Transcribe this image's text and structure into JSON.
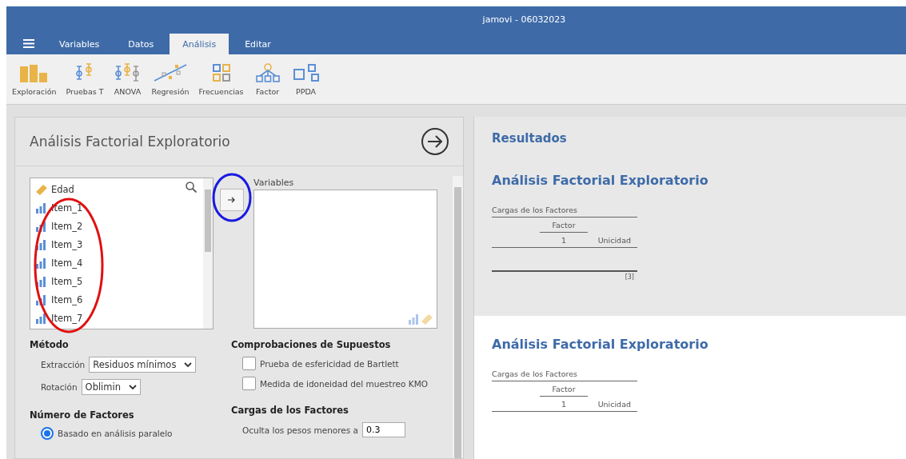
{
  "window": {
    "title": "jamovi - 06032023"
  },
  "tabs": [
    {
      "label": "Variables",
      "selected": false
    },
    {
      "label": "Datos",
      "selected": false
    },
    {
      "label": "Análisis",
      "selected": true
    },
    {
      "label": "Editar",
      "selected": false
    }
  ],
  "ribbon": [
    {
      "label": "Exploración",
      "kind": "exploration"
    },
    {
      "label": "Pruebas T",
      "kind": "ttest"
    },
    {
      "label": "ANOVA",
      "kind": "anova"
    },
    {
      "label": "Regresión",
      "kind": "regression"
    },
    {
      "label": "Frecuencias",
      "kind": "frequencies"
    },
    {
      "label": "Factor",
      "kind": "factor"
    },
    {
      "label": "PPDA",
      "kind": "ppda"
    }
  ],
  "analysis_panel": {
    "title": "Análisis Factorial Exploratorio",
    "source_list": [
      {
        "name": "Edad",
        "kind": "continuous"
      },
      {
        "name": "Item_1",
        "kind": "ordinal"
      },
      {
        "name": "Item_2",
        "kind": "ordinal"
      },
      {
        "name": "Item_3",
        "kind": "ordinal"
      },
      {
        "name": "Item_4",
        "kind": "ordinal"
      },
      {
        "name": "Item_5",
        "kind": "ordinal"
      },
      {
        "name": "Item_6",
        "kind": "ordinal"
      },
      {
        "name": "Item_7",
        "kind": "ordinal"
      }
    ],
    "variables_label": "Variables",
    "method": {
      "heading": "Método",
      "extraction_label": "Extracción",
      "extraction_value": "Residuos mínimos",
      "rotation_label": "Rotación",
      "rotation_value": "Oblimin"
    },
    "factors": {
      "heading": "Número de Factores",
      "options": [
        {
          "label": "Basado en análisis paralelo",
          "selected": true
        }
      ]
    },
    "assumptions": {
      "heading": "Comprobaciones de Supuestos",
      "checks": [
        {
          "label": "Prueba de esfericidad de Bartlett",
          "checked": false
        },
        {
          "label": "Medida de idoneidad del muestreo KMO",
          "checked": false
        }
      ]
    },
    "loadings": {
      "heading": "Cargas de los Factores",
      "hide_label": "Oculta los pesos menores a",
      "hide_value": "0.3"
    }
  },
  "annotations": [
    {
      "color": "#e01010"
    },
    {
      "color": "#1a1ae0"
    }
  ],
  "results": {
    "heading": "Resultados",
    "sections": [
      {
        "title": "Análisis Factorial Exploratorio",
        "selected": false,
        "table": {
          "title": "Cargas de los Factores",
          "spanner": "Factor",
          "columns": [
            "1",
            "Unicidad"
          ],
          "footnote": "[3]"
        }
      },
      {
        "title": "Análisis Factorial Exploratorio",
        "selected": true,
        "table": {
          "title": "Cargas de los Factores",
          "spanner": "Factor",
          "columns": [
            "1",
            "Unicidad"
          ]
        }
      }
    ]
  }
}
